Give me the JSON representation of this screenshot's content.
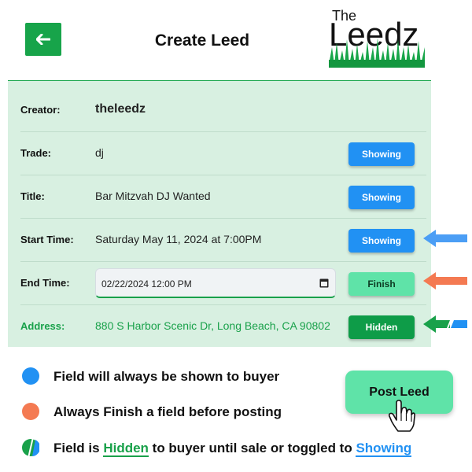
{
  "header": {
    "title": "Create Leed",
    "back_icon": "arrow-left-icon",
    "logo": {
      "line1": "The",
      "line2": "Leedz"
    }
  },
  "form": {
    "creator": {
      "label": "Creator:",
      "value": "theleedz"
    },
    "trade": {
      "label": "Trade:",
      "value": "dj",
      "toggle": "Showing"
    },
    "title": {
      "label": "Title:",
      "value": "Bar Mitzvah DJ Wanted",
      "toggle": "Showing"
    },
    "start_time": {
      "label": "Start Time:",
      "value": "Saturday May 11, 2024 at 7:00PM",
      "toggle": "Showing"
    },
    "end_time": {
      "label": "End Time:",
      "value": "02/22/2024 12:00 PM",
      "toggle": "Finish"
    },
    "address": {
      "label": "Address:",
      "value": "880 S Harbor Scenic Dr, Long Beach, CA 90802",
      "toggle": "Hidden"
    }
  },
  "legend": {
    "showing_text": "Field will always be shown to buyer",
    "finish_text": "Always Finish a field before posting",
    "hidden_prefix": "Field is",
    "hidden_word": "Hidden",
    "hidden_middle": "to buyer until sale or toggled to",
    "showing_word": "Showing"
  },
  "post_button": {
    "label": "Post Leed"
  },
  "colors": {
    "brand_green": "#17a44a",
    "showing_blue": "#2191f3",
    "finish_orange": "#f47a52",
    "mint": "#5fe3a8",
    "card_bg": "#d8f0e1"
  }
}
